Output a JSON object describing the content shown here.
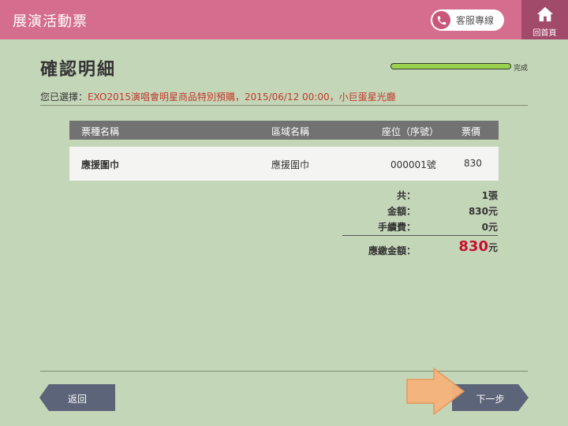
{
  "header": {
    "app_title": "展演活動票",
    "service_label": "客服專線",
    "home_label": "回首頁"
  },
  "page": {
    "title": "確認明細",
    "progress_label": "完成",
    "progress_fraction": 1.0
  },
  "selection": {
    "label": "您已選擇：",
    "value": "EXO2015演唱會明星商品特別預購，2015/06/12 00:00，小巨蛋星光廳"
  },
  "table": {
    "headers": [
      "票種名稱",
      "區域名稱",
      "座位（序號）",
      "票價"
    ],
    "rows": [
      {
        "ticket_type": "應援圍巾",
        "area": "應援圍巾",
        "seat": "000001號",
        "price": "830"
      }
    ]
  },
  "summary": {
    "count_label": "共：",
    "count_value": "1張",
    "amount_label": "金額：",
    "amount_value": "830元",
    "fee_label": "手續費：",
    "fee_value": "0元",
    "total_label": "應繳金額：",
    "total_number": "830",
    "total_unit": "元"
  },
  "nav": {
    "back_label": "返回",
    "next_label": "下一步"
  },
  "colors": {
    "header_bg": "#d56e8e",
    "home_bg": "#a24a69",
    "page_bg": "#c4d6b8",
    "progress_fill": "#9ad24e",
    "total_red": "#c8102e",
    "button_bg": "#5b6478",
    "pointer_arrow": "#f6b47a"
  }
}
